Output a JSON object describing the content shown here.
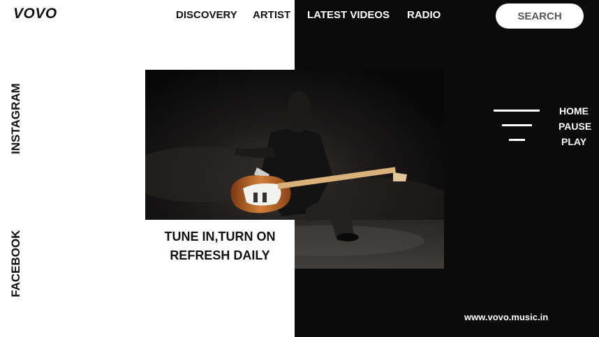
{
  "brand": {
    "logo": "VOVO"
  },
  "nav": {
    "items": [
      {
        "label": "DISCOVERY"
      },
      {
        "label": "ARTIST"
      },
      {
        "label": "LATEST VIDEOS"
      },
      {
        "label": "RADIO"
      }
    ],
    "search_label": "SEARCH"
  },
  "social": {
    "instagram": "INSTAGRAM",
    "facebook": "FACEBOOK"
  },
  "hero": {
    "tagline_line1": "TUNE IN,TURN ON",
    "tagline_line2": "REFRESH DAILY"
  },
  "side_menu": {
    "items": [
      {
        "label": "HOME"
      },
      {
        "label": "PAUSE"
      },
      {
        "label": "PLAY"
      }
    ]
  },
  "footer": {
    "url": "www.vovo.music.in"
  },
  "colors": {
    "dark_panel": "#0c0b0b",
    "light_bg": "#ffffff",
    "guitar_body": "#c46a2a"
  }
}
